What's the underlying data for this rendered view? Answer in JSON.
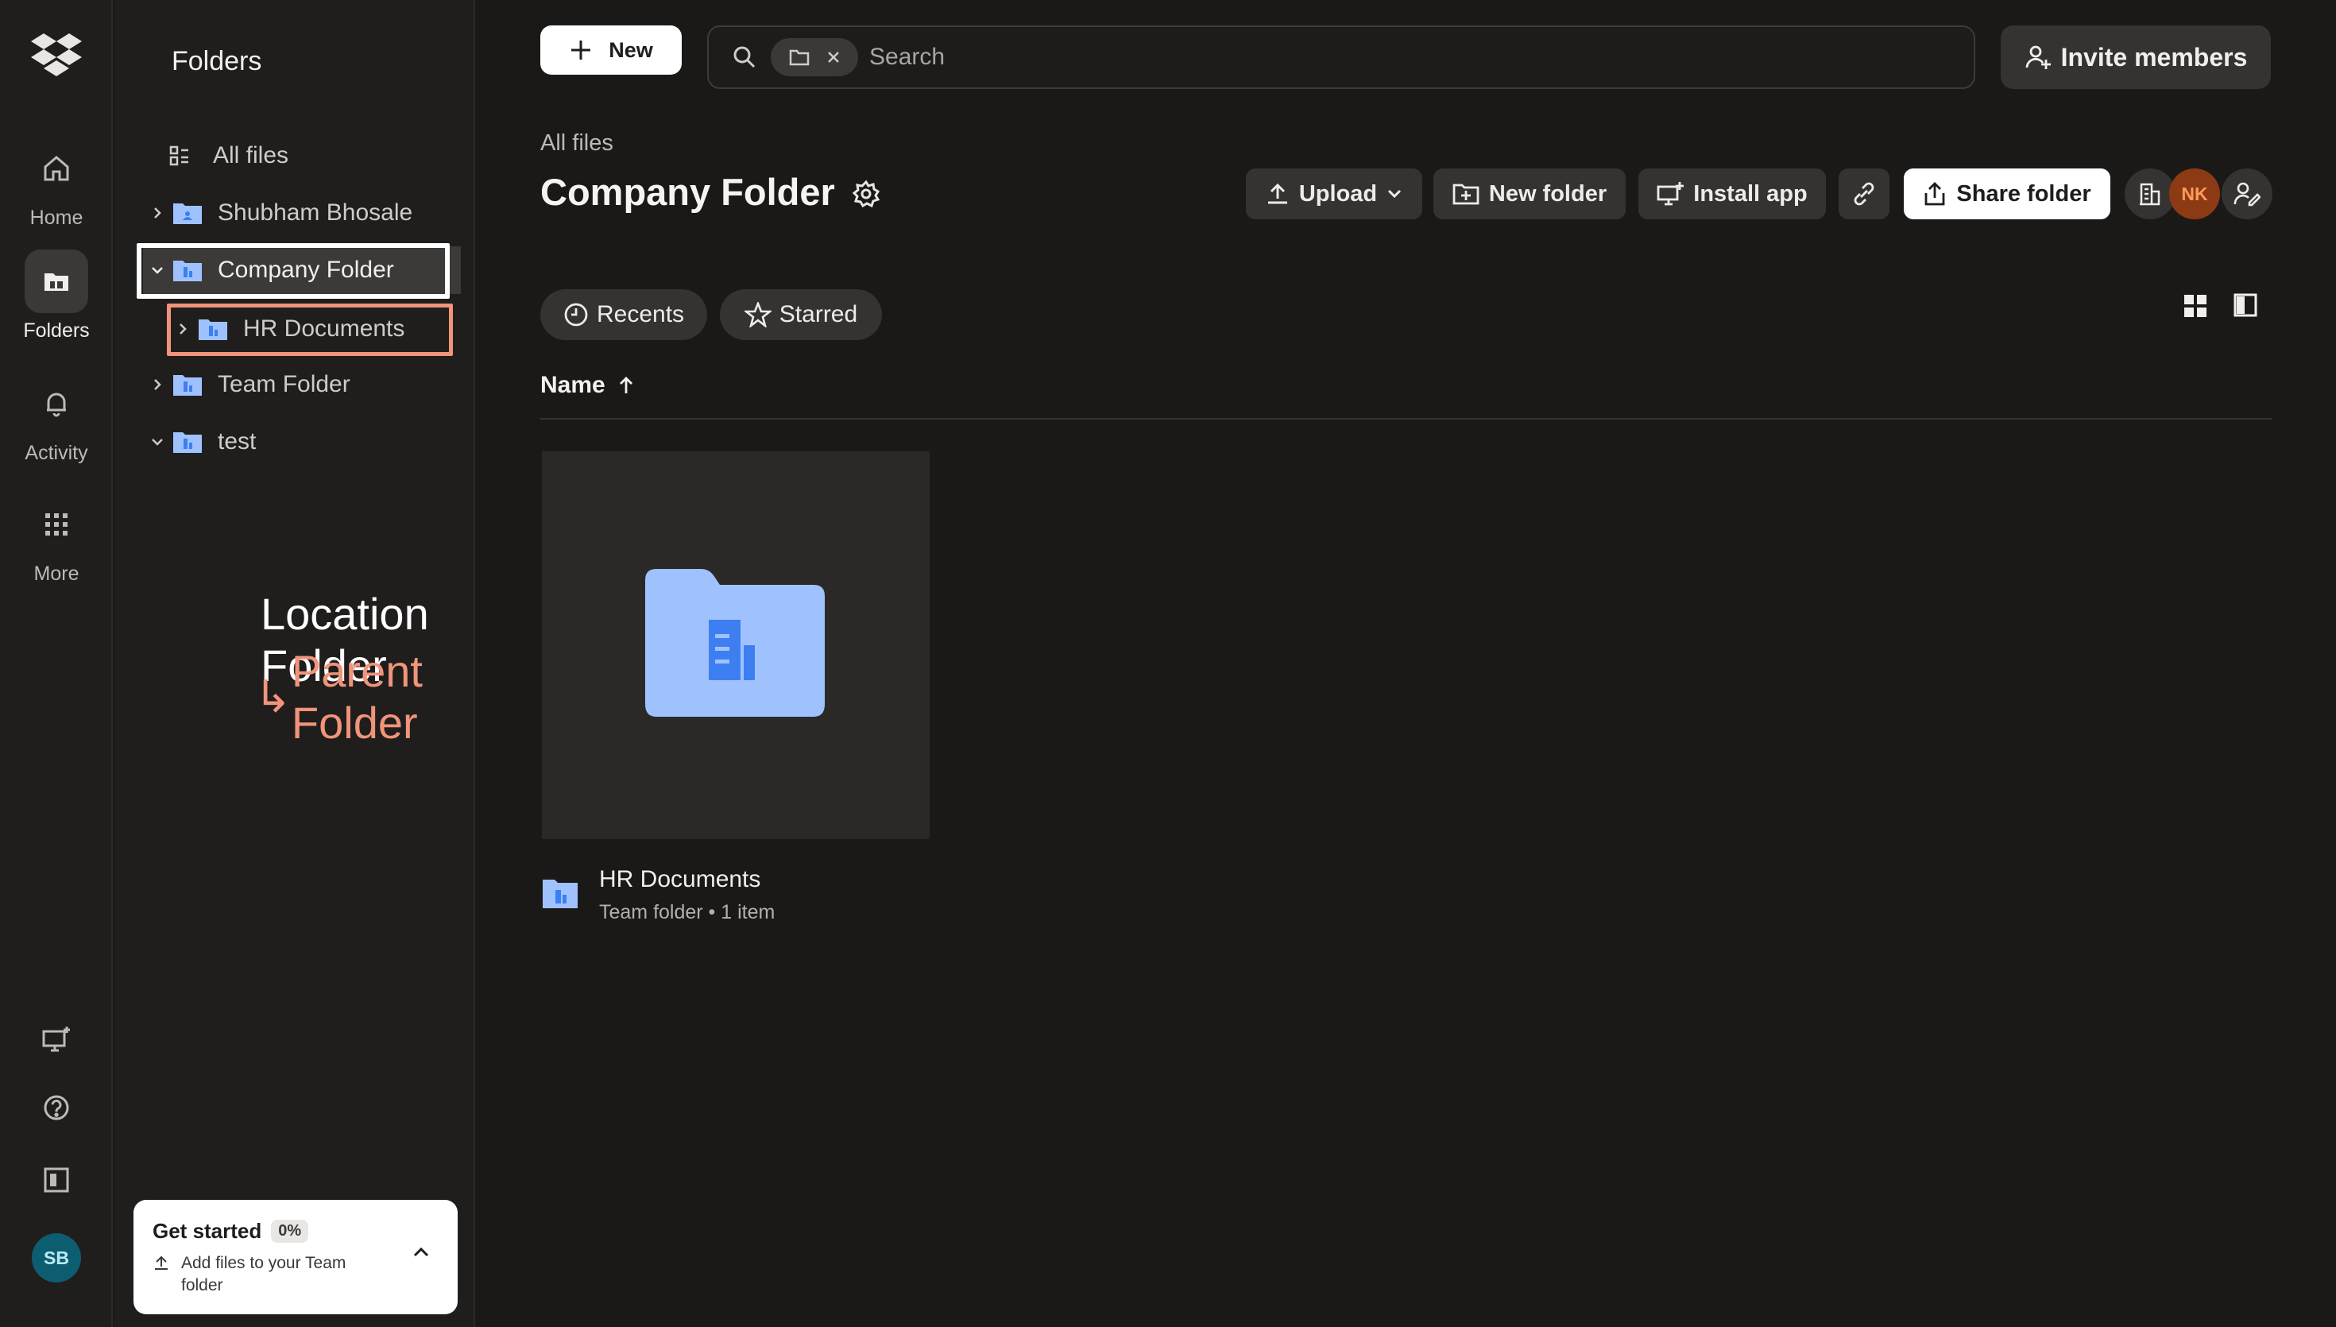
{
  "rail": {
    "items": [
      {
        "label": "Home",
        "icon": "home-icon"
      },
      {
        "label": "Folders",
        "icon": "folders-icon",
        "active": true
      },
      {
        "label": "Activity",
        "icon": "bell-icon"
      },
      {
        "label": "More",
        "icon": "grid-dots-icon"
      }
    ],
    "user_initials": "SB"
  },
  "tree": {
    "title": "Folders",
    "all_files": "All files",
    "items": [
      {
        "label": "Shubham Bhosale",
        "expanded": false
      },
      {
        "label": "Company Folder",
        "expanded": true,
        "selected": true
      },
      {
        "label": "HR Documents",
        "expanded": false
      },
      {
        "label": "Team Folder",
        "expanded": false
      },
      {
        "label": "test",
        "expanded": true
      }
    ]
  },
  "annotation": {
    "location": "Location Folder",
    "parent": "Parent Folder",
    "arrow": "↳",
    "location_color": "#ffffff",
    "parent_color": "#f1947a"
  },
  "get_started": {
    "title": "Get started",
    "percent": "0%",
    "subtitle": "Add files to your Team folder"
  },
  "topbar": {
    "new_label": "New",
    "search_placeholder": "Search",
    "invite_label": "Invite members"
  },
  "header": {
    "breadcrumb": "All files",
    "title": "Company Folder"
  },
  "toolbar": {
    "upload": "Upload",
    "new_folder": "New folder",
    "install_app": "Install app",
    "share_folder": "Share folder",
    "member_initials": "NK"
  },
  "filters": {
    "recents": "Recents",
    "starred": "Starred"
  },
  "table": {
    "name_header": "Name"
  },
  "files": [
    {
      "name": "HR Documents",
      "meta": "Team folder • 1 item"
    }
  ],
  "colors": {
    "folder_blue": "#9fc2ff",
    "folder_dark": "#3d7ff0",
    "avatar_sb": "#0d5d70",
    "avatar_nk": "#8c3a13"
  }
}
